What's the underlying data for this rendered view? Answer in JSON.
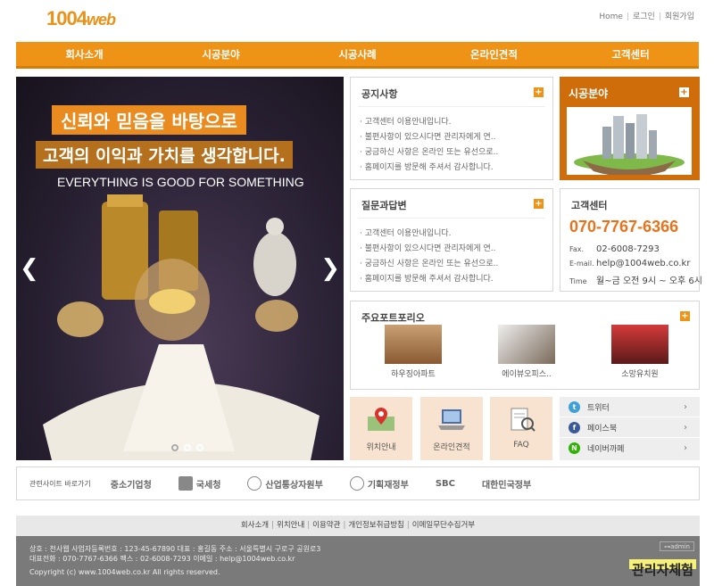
{
  "brand": {
    "logo_num": "1004",
    "logo_web": "web",
    "accent": "#ef9317"
  },
  "toplinks": [
    "Home",
    "로그인",
    "회원가입"
  ],
  "gnb": [
    "회사소개",
    "시공분야",
    "시공사례",
    "온라인견적",
    "고객센터"
  ],
  "slider": {
    "caption1": "신뢰와 믿음을 바탕으로",
    "caption2": "고객의 이익과 가치를 생각합니다.",
    "caption3": "EVERYTHING IS GOOD FOR SOMETHING",
    "prev": "❮",
    "next": "❯"
  },
  "notice": {
    "title": "공지사항",
    "items": [
      "· 고객센터 이용안내입니다.",
      "· 불편사항이 있으시다면 관리자에게 연..",
      "· 궁금하신 사항은 온라인 또는 유선으로..",
      "· 홈페이지를 방문해 주셔서 감사합니다."
    ]
  },
  "qna": {
    "title": "질문과답변",
    "items": [
      "· 고객센터 이용안내입니다.",
      "· 불편사항이 있으시다면 관리자에게 연..",
      "· 궁금하신 사항은 온라인 또는 유선으로..",
      "· 홈페이지를 방문해 주셔서 감사합니다."
    ]
  },
  "field_box": {
    "title": "시공분야"
  },
  "customer_center": {
    "title": "고객센터",
    "phone": "070-7767-6366",
    "fax_label": "Fax.",
    "fax": "02-6008-7293",
    "email_label": "E-mail.",
    "email": "help@1004web.co.kr",
    "time_label": "Time",
    "time": "월~금 오전 9시 ~ 오후 6시"
  },
  "portfolio": {
    "title": "주요포트포리오",
    "items": [
      "하우징아파트",
      "에이뷰오피스..",
      "소망유치원"
    ]
  },
  "quick": [
    "위치안내",
    "온라인견적",
    "FAQ"
  ],
  "sns": [
    {
      "label": "트위터",
      "color": "#3fa0d8",
      "glyph": "t"
    },
    {
      "label": "페이스북",
      "color": "#3b5998",
      "glyph": "f"
    },
    {
      "label": "네이버까페",
      "color": "#2db400",
      "glyph": "N"
    }
  ],
  "related": {
    "label": "관련사이트 바로가기",
    "sites": [
      "중소기업청",
      "국세청",
      "산업통상자원부",
      "기획재정부",
      "SBC",
      "대한민국정부"
    ]
  },
  "footer": {
    "links": [
      "회사소개",
      "위치안내",
      "이용약관",
      "개인정보취급방침",
      "이메일무단수집거부"
    ],
    "line1": "상호 : 천사웹  사업자등록번호 : 123-45-67890  대표 : 홍길동  주소 : 서울특별시 구로구 공원로3",
    "line2": "대표전화 : 070-7767-6366  팩스 : 02-6008-7293  이메일 : help@1004web.co.kr",
    "copyright": "Copyright (c) www.1004web.co.kr All rights reserved.",
    "admin": "⊶admin",
    "trial": "관리자체험"
  }
}
